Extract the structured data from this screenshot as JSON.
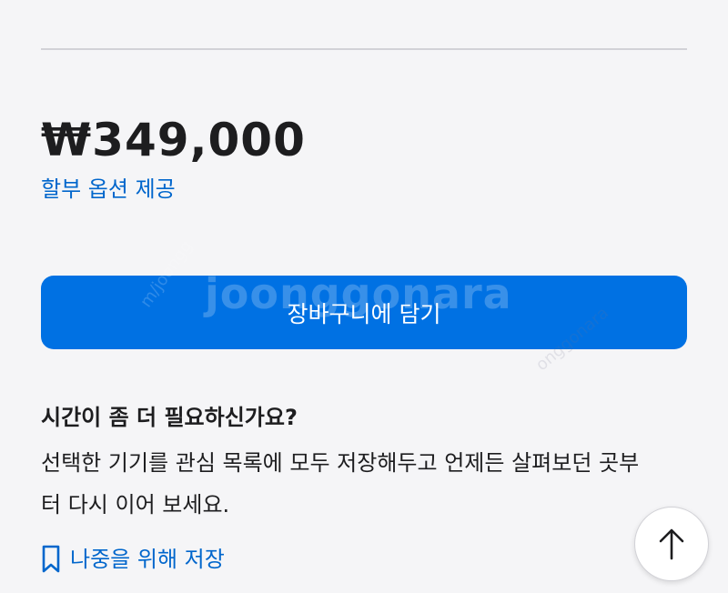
{
  "product": {
    "price": "₩349,000",
    "installment_link": "할부 옵션 제공"
  },
  "cart": {
    "add_button_label": "장바구니에 담기"
  },
  "watermark": {
    "main": "joonggonara",
    "small_left": "m/joongg",
    "small_right": "onggonara"
  },
  "save_for_later": {
    "heading": "시간이 좀 더 필요하신가요?",
    "description": "선택한 기기를 관심 목록에 모두 저장해두고 언제든 살펴보던 곳부터 다시 이어 보세요.",
    "link_label": "나중을 위해 저장",
    "link_icon": "bookmark-icon"
  },
  "scroll_top": {
    "icon": "arrow-up-icon"
  },
  "colors": {
    "accent_blue": "#0071e3",
    "link_blue": "#0066cc",
    "background": "#f5f5f7",
    "text": "#1d1d1f"
  }
}
